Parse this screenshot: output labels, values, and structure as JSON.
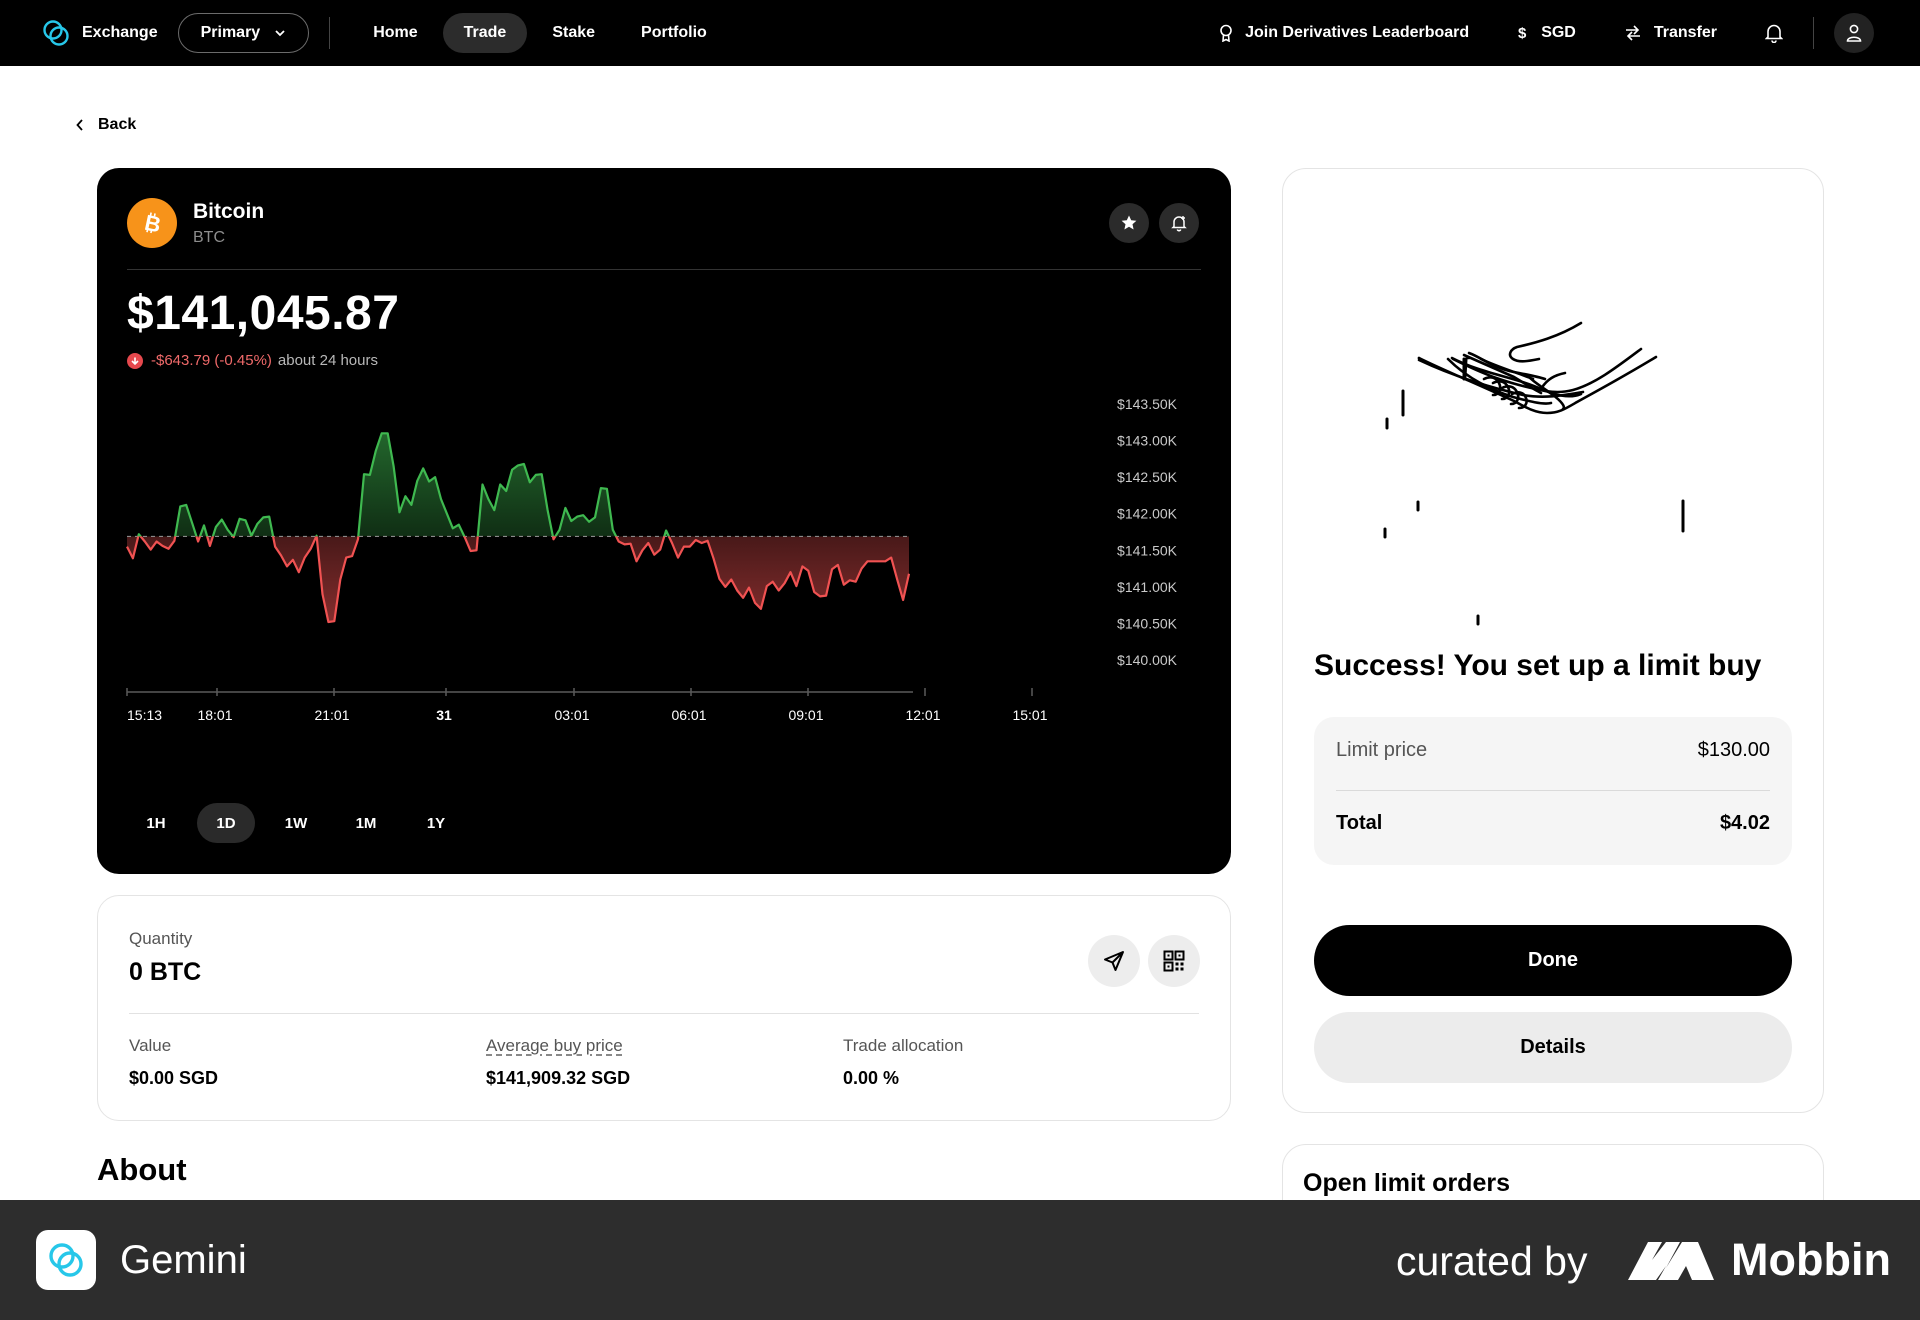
{
  "nav": {
    "brand": "Exchange",
    "account": "Primary",
    "links": [
      "Home",
      "Trade",
      "Stake",
      "Portfolio"
    ],
    "active_link": "Trade",
    "leaderboard": "Join Derivatives Leaderboard",
    "currency": "SGD",
    "transfer": "Transfer"
  },
  "back_label": "Back",
  "asset": {
    "name": "Bitcoin",
    "symbol": "BTC",
    "price": "$141,045.87",
    "change": "-$643.79 (-0.45%)",
    "change_period": "about 24 hours"
  },
  "chart_data": {
    "type": "line",
    "y_tick_labels": [
      "$143.50K",
      "$143.00K",
      "$142.50K",
      "$142.00K",
      "$141.50K",
      "$141.00K",
      "$140.50K",
      "$140.00K"
    ],
    "ylim": [
      140000,
      143500
    ],
    "x_tick_labels": [
      "15:13",
      "18:01",
      "21:01",
      "31",
      "03:01",
      "06:01",
      "09:01",
      "12:01",
      "15:01"
    ],
    "reference_value": 141689.66,
    "colors": {
      "above": "#3fb950",
      "below": "#f05252"
    },
    "series": [
      {
        "values": [
          141550,
          141390,
          141720,
          141620,
          141510,
          141620,
          141560,
          141520,
          141630,
          142100,
          142120,
          141870,
          141620,
          141840,
          141560,
          141820,
          141920,
          141780,
          141680,
          141930,
          141910,
          141700,
          141860,
          141950,
          141960,
          141550,
          141430,
          141280,
          141370,
          141200,
          141400,
          141520,
          141700,
          140900,
          140520,
          140530,
          141100,
          141400,
          141420,
          141650,
          142540,
          142530,
          142860,
          143100,
          143100,
          142650,
          142020,
          142240,
          142120,
          142450,
          142620,
          142440,
          142500,
          142200,
          142000,
          141800,
          141850,
          141680,
          141490,
          141500,
          142400,
          142200,
          142050,
          142400,
          142310,
          142600,
          142660,
          142680,
          142430,
          142530,
          142540,
          142050,
          141650,
          141780,
          142080,
          141900,
          141960,
          141980,
          141890,
          141950,
          142350,
          142340,
          141780,
          141620,
          141580,
          141590,
          141350,
          141500,
          141600,
          141440,
          141510,
          141770,
          141600,
          141400,
          141550,
          141550,
          141640,
          141600,
          141630,
          141390,
          141110,
          141000,
          141100,
          140950,
          140850,
          140990,
          140780,
          140700,
          141010,
          141070,
          140950,
          141050,
          141200,
          141010,
          141280,
          141220,
          140930,
          140870,
          140880,
          141240,
          141300,
          141030,
          141090,
          141070,
          141250,
          141350,
          141350,
          141350,
          141350,
          141400,
          141100,
          140820,
          141180
        ]
      }
    ]
  },
  "ranges": [
    "1H",
    "1D",
    "1W",
    "1M",
    "1Y"
  ],
  "active_range": "1D",
  "holdings": {
    "quantity_label": "Quantity",
    "quantity_value": "0 BTC",
    "value_label": "Value",
    "value": "$0.00 SGD",
    "avg_label": "Average buy price",
    "avg_value": "$141,909.32 SGD",
    "alloc_label": "Trade allocation",
    "alloc_value": "0.00 %"
  },
  "about_title": "About",
  "success": {
    "title": "Success! You set up a limit buy",
    "limit_price_label": "Limit price",
    "limit_price_value": "$130.00",
    "total_label": "Total",
    "total_value": "$4.02",
    "done_label": "Done",
    "details_label": "Details"
  },
  "open_orders_title": "Open limit orders",
  "footer": {
    "app_name": "Gemini",
    "curated_by": "curated by",
    "brand": "Mobbin"
  }
}
